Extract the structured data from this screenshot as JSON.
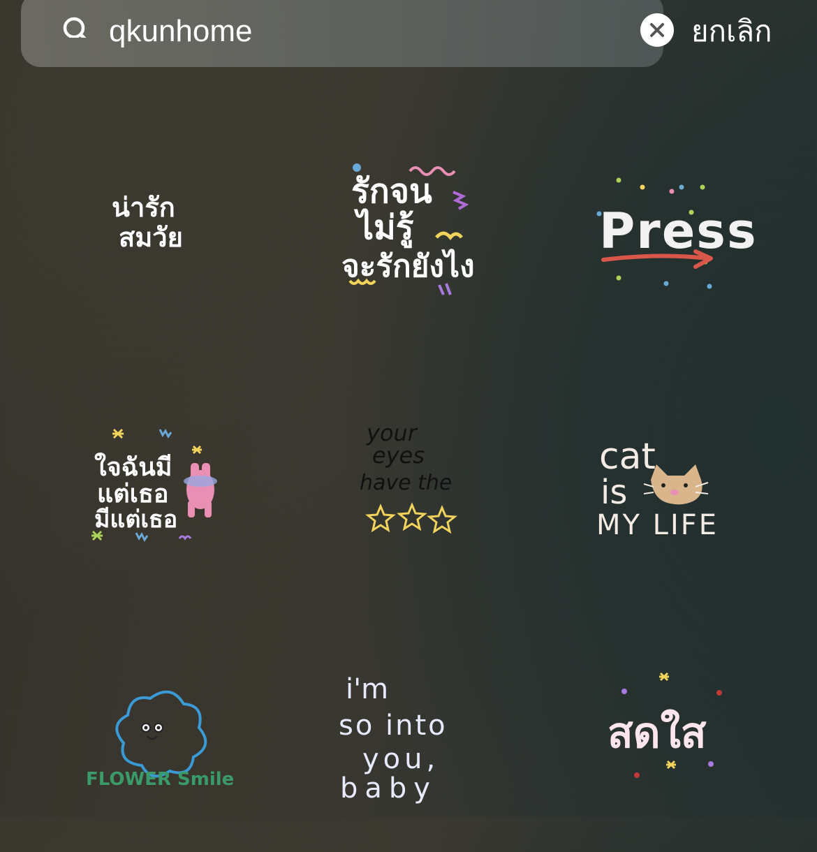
{
  "search": {
    "query": "qkunhome",
    "cancel_label": "ยกเลิก"
  },
  "stickers": [
    {
      "lines": [
        "น่ารัก",
        "สมวัย"
      ],
      "color": "#ffffff"
    },
    {
      "lines": [
        "รักจน",
        "ไม่รู้",
        "จะรักยังไง"
      ],
      "color": "#ffffff"
    },
    {
      "lines": [
        "Press"
      ],
      "color": "#f2f2f2"
    },
    {
      "lines": [
        "ใจฉันมี",
        "แต่เธอ",
        "มีแต่เธอ"
      ],
      "color": "#ffffff"
    },
    {
      "lines": [
        "your",
        "eyes",
        "have the"
      ],
      "color": "#111111"
    },
    {
      "lines": [
        "cat",
        "is",
        "MY LIFE"
      ],
      "color": "#f4ece4"
    },
    {
      "lines": [
        "FLOWER Smile"
      ],
      "color": "#3a9a6a"
    },
    {
      "lines": [
        "i'm",
        "so into",
        "you,",
        "baby"
      ],
      "color": "#e8eaff"
    },
    {
      "lines": [
        "สดใส"
      ],
      "color": "#ffe6ec"
    }
  ],
  "colors": {
    "accent_pink": "#e98fb3",
    "accent_yellow": "#f2d35c",
    "accent_blue": "#3a9ad6",
    "arrow_red": "#d9574a"
  }
}
